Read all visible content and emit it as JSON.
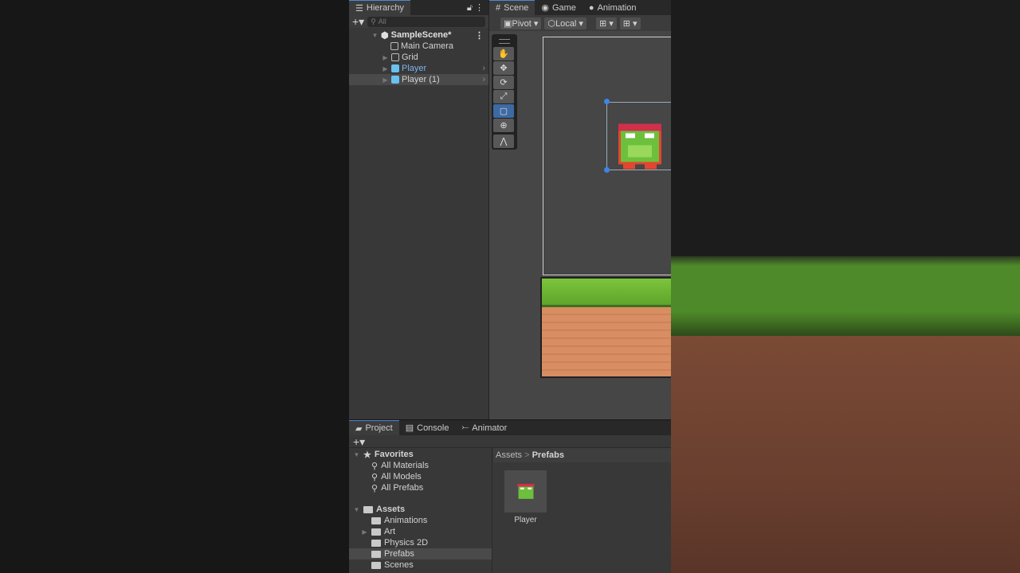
{
  "hierarchy": {
    "tab": "Hierarchy",
    "search_placeholder": "All",
    "scene": "SampleScene*",
    "items": [
      {
        "label": "Main Camera"
      },
      {
        "label": "Grid"
      },
      {
        "label": "Player"
      },
      {
        "label": "Player (1)"
      }
    ]
  },
  "scene_tabs": [
    {
      "label": "Scene"
    },
    {
      "label": "Game"
    },
    {
      "label": "Animation"
    }
  ],
  "scene_toolbar": {
    "pivot": "Pivot",
    "local": "Local"
  },
  "project": {
    "tabs": [
      {
        "label": "Project"
      },
      {
        "label": "Console"
      },
      {
        "label": "Animator"
      }
    ],
    "favorites": {
      "label": "Favorites",
      "items": [
        "All Materials",
        "All Models",
        "All Prefabs"
      ]
    },
    "assets": {
      "label": "Assets",
      "items": [
        "Animations",
        "Art",
        "Physics 2D",
        "Prefabs",
        "Scenes"
      ]
    },
    "breadcrumb": {
      "root": "Assets",
      "current": "Prefabs"
    },
    "files": [
      {
        "label": "Player"
      }
    ]
  }
}
